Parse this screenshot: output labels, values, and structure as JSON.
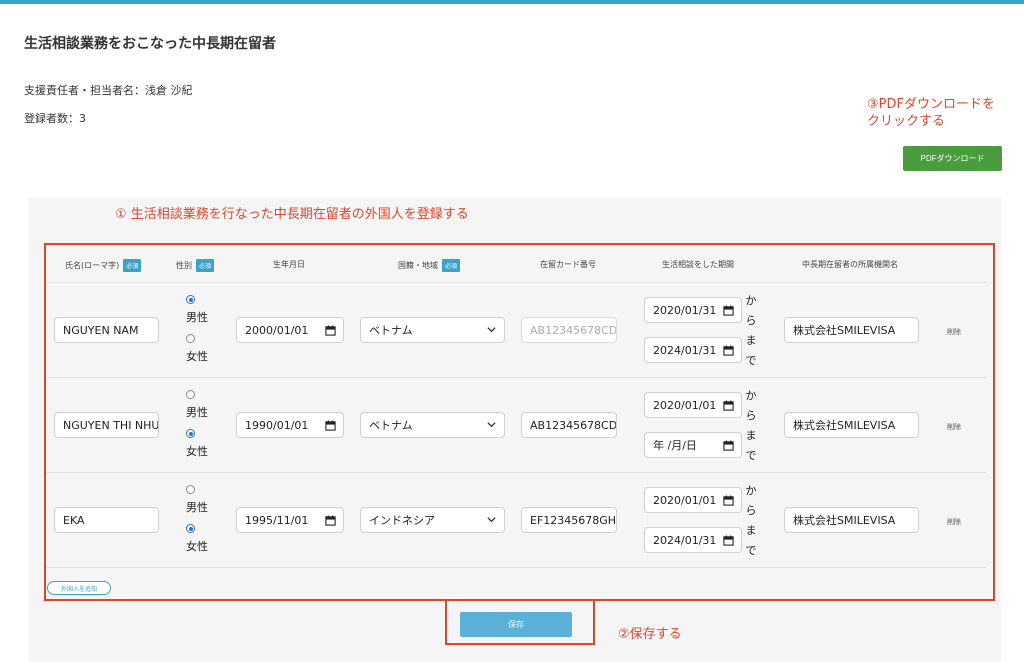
{
  "page": {
    "title": "生活相談業務をおこなった中長期在留者",
    "supervisor": "支援責任者・担当者名：浅倉 沙紀",
    "count": "登録者数：3"
  },
  "annotations": {
    "pdf_line1": "③PDFダウンロードを",
    "pdf_line2": "クリックする",
    "register": "① 生活相談業務を行なった中長期在留者の外国人を登録する",
    "save": "②保存する"
  },
  "buttons": {
    "pdf": "PDFダウンロード",
    "add": "外国人を追加",
    "save": "保存",
    "delete": "削除"
  },
  "required_badge": "必須",
  "columns": {
    "name": "氏名(ローマ字)",
    "gender": "性別",
    "birthdate": "生年月日",
    "nationality": "国籍・地域",
    "card": "在留カード番号",
    "period": "生活相談をした期間",
    "org": "中長期在留者の所属機関名"
  },
  "gender_labels": {
    "male": "男性",
    "female": "女性"
  },
  "period_labels": {
    "from1": "か",
    "from2": "ら",
    "to1": "ま",
    "to2": "で"
  },
  "rows": [
    {
      "name": "NGUYEN NAM",
      "gender": "male",
      "birthdate": "2000/01/01",
      "nationality": "ベトナム",
      "card": "AB12345678CD",
      "card_placeholder": true,
      "from": "2020/01/31",
      "to": "2024/01/31",
      "org": "株式会社SMILEVISA"
    },
    {
      "name": "NGUYEN THI NHU",
      "gender": "female",
      "birthdate": "1990/01/01",
      "nationality": "ベトナム",
      "card": "AB12345678CD",
      "card_placeholder": false,
      "from": "2020/01/01",
      "to": "年 /月/日",
      "org": "株式会社SMILEVISA"
    },
    {
      "name": "EKA",
      "gender": "female",
      "birthdate": "1995/11/01",
      "nationality": "インドネシア",
      "card": "EF12345678GH",
      "card_placeholder": false,
      "from": "2020/01/01",
      "to": "2024/01/31",
      "org": "株式会社SMILEVISA"
    }
  ],
  "colors": {
    "accent": "#3aa3c8",
    "annotation": "#e0452b",
    "pdf_button": "#4a9c3f",
    "save_button": "#5bb0d8"
  },
  "icons": {
    "date": "calendar-icon",
    "select": "chevron-down-icon"
  }
}
